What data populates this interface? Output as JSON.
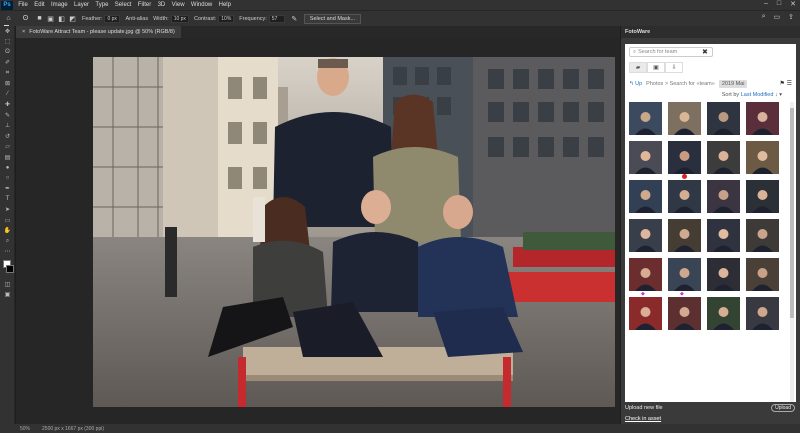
{
  "menubar": {
    "logo": "Ps",
    "items": [
      "File",
      "Edit",
      "Image",
      "Layer",
      "Type",
      "Select",
      "Filter",
      "3D",
      "View",
      "Window",
      "Help"
    ]
  },
  "options": {
    "feather_label": "Feather:",
    "feather_value": "0 px",
    "antialias_label": "Anti-alias",
    "width_label": "Width:",
    "width_value": "10 px",
    "contrast_label": "Contrast:",
    "contrast_value": "10%",
    "frequency_label": "Frequency:",
    "frequency_value": "57",
    "select_mask_label": "Select and Mask..."
  },
  "document": {
    "tab_title": "FotoWare Attract Team - please update.jpg @ 50% (RGB/8)",
    "zoom": "50%",
    "info": "2500 px x 1667 px (300 ppi)"
  },
  "panel": {
    "title": "FotoWare",
    "search_placeholder": "Search for team",
    "up_label": "Up",
    "breadcrumb": "Photos > Search for «team»",
    "year_chip": "2019 Mai",
    "sort_prefix": "Sort by",
    "sort_value": "Last Modified",
    "upload_label": "Upload new file",
    "upload_button": "Upload",
    "checkin_label": "Check in asset"
  },
  "colors": {
    "accent": "#1f6fc5",
    "app_bg": "#323232",
    "canvas_bg": "#262626"
  }
}
